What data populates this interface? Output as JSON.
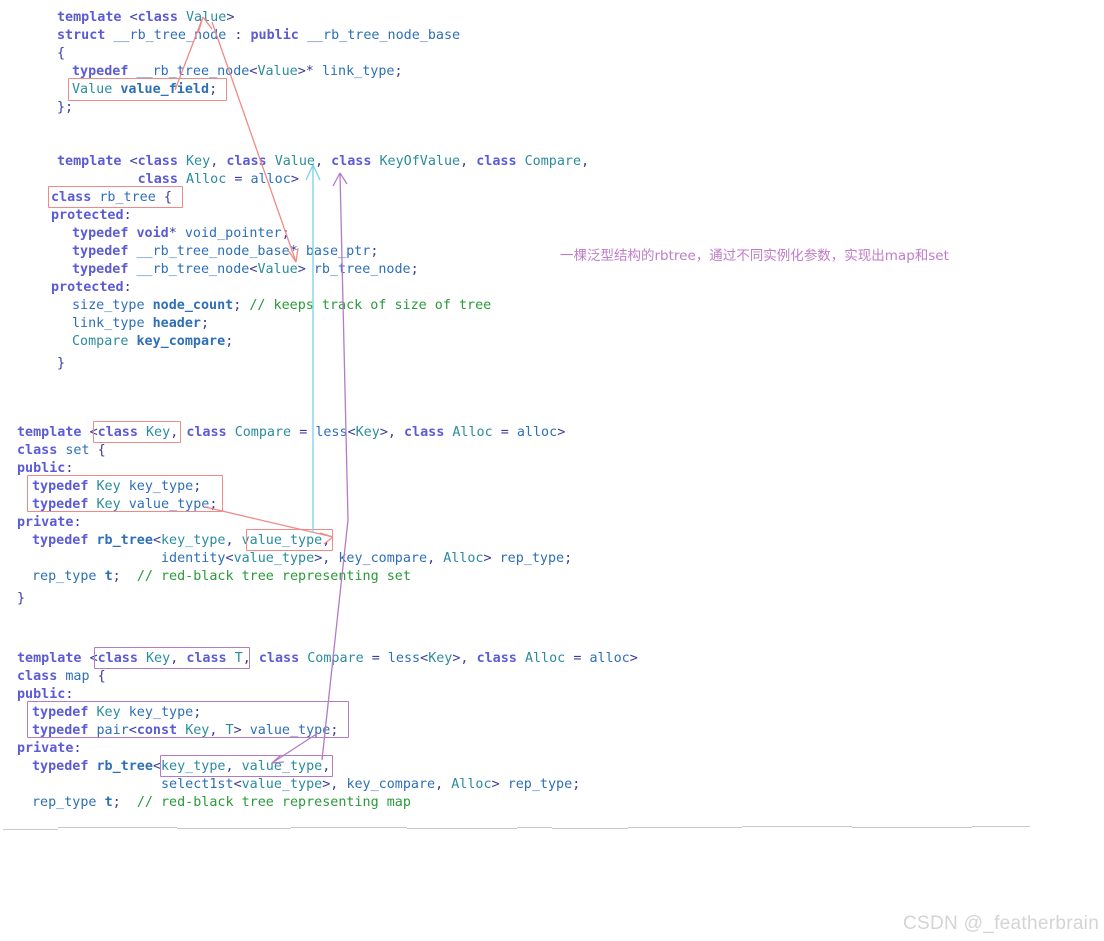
{
  "page": {
    "watermark": "CSDN @_featherbrain",
    "background_color": "#ffffff"
  },
  "annotation_note": {
    "text": "一棵泛型结构的rbtree，通过不同实例化参数，实现出map和set",
    "color": "#c07cc8"
  },
  "colors": {
    "keyword": "#5b5bd6",
    "type": "#2a8c9e",
    "identifier": "#2d6fb8",
    "comment": "#2a9a3a",
    "annotation_red": "#f08a86",
    "annotation_purple": "#b47bc4",
    "annotation_cyan": "#7fd4ea",
    "rule_gray": "#c9c9c9",
    "watermark_gray": "#d4d4d4"
  },
  "code": {
    "node_block": [
      "template <class Value>",
      "struct __rb_tree_node : public __rb_tree_node_base",
      "{",
      "  typedef __rb_tree_node<Value>* link_type;",
      "  Value value_field;",
      "};"
    ],
    "rbtree_block": [
      "template <class Key, class Value, class KeyOfValue, class Compare,",
      "          class Alloc = alloc>",
      "class rb_tree {",
      "protected:",
      "  typedef void* void_pointer;",
      "  typedef __rb_tree_node_base* base_ptr;",
      "  typedef __rb_tree_node<Value> rb_tree_node;",
      "protected:",
      "  size_type node_count; // keeps track of size of tree",
      "  link_type header;",
      "  Compare key_compare;",
      "}"
    ],
    "set_block": [
      "template <class Key, class Compare = less<Key>, class Alloc = alloc>",
      "class set {",
      "public:",
      "  typedef Key key_type;",
      "  typedef Key value_type;",
      "private:",
      "  typedef rb_tree<key_type, value_type,",
      "                  identity<value_type>, key_compare, Alloc> rep_type;",
      "  rep_type t;  // red-black tree representing set",
      "}"
    ],
    "map_block": [
      "template <class Key, class T, class Compare = less<Key>, class Alloc = alloc>",
      "class map {",
      "public:",
      "  typedef Key key_type;",
      "  typedef pair<const Key, T> value_type;",
      "private:",
      "  typedef rb_tree<key_type, value_type,",
      "                  select1st<value_type>, key_compare, Alloc> rep_type;",
      "  rep_type t;  // red-black tree representing map"
    ]
  },
  "highlight_boxes": [
    {
      "name": "value-field-box",
      "color": "#f08a86"
    },
    {
      "name": "class-rb-tree-box",
      "color": "#f08a86"
    },
    {
      "name": "set-class-key-box",
      "color": "#f08a86"
    },
    {
      "name": "set-typedefs-box",
      "color": "#f08a86"
    },
    {
      "name": "set-value-type-box",
      "color": "#f08a86"
    },
    {
      "name": "map-class-key-t-box",
      "color": "#b47bc4"
    },
    {
      "name": "map-typedefs-box",
      "color": "#b47bc4"
    },
    {
      "name": "map-key-value-type-box",
      "color": "#b47bc4"
    }
  ]
}
